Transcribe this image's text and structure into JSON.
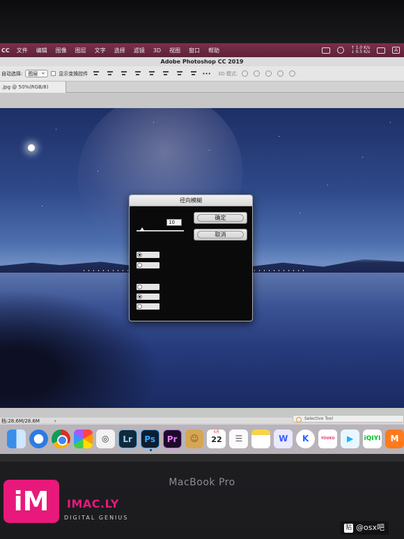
{
  "menubar": {
    "app_name": "CC",
    "items": [
      "文件",
      "编辑",
      "图像",
      "图层",
      "文字",
      "选择",
      "滤镜",
      "3D",
      "视图",
      "窗口",
      "帮助"
    ],
    "net_up": "↑ 1.0 K/s",
    "net_down": "↓ 0.5 K/s",
    "input_method": "A"
  },
  "photoshop": {
    "window_title": "Adobe Photoshop CC 2019",
    "options": {
      "auto_select_label": "自动选择:",
      "auto_select_value": "图层",
      "show_transform_label": "显示变换控件",
      "more": "•••",
      "mode_3d": "3D 模式:"
    },
    "document_tab": ".jpg @ 50%(RGB/8)",
    "status_doc": "档:28.6M/28.6M",
    "status_chevron": "›"
  },
  "dialog": {
    "title": "径向模糊",
    "amount_value": "10",
    "ok_label": "确定",
    "cancel_label": "取消"
  },
  "selective_tool": "Selective Tool",
  "dock": {
    "items": [
      {
        "name": "finder-icon",
        "glyph": ""
      },
      {
        "name": "safari-icon",
        "glyph": ""
      },
      {
        "name": "chrome-icon",
        "glyph": ""
      },
      {
        "name": "photos-icon",
        "glyph": ""
      },
      {
        "name": "screenshot-icon",
        "glyph": "◎"
      },
      {
        "name": "lightroom-icon",
        "glyph": "Lr"
      },
      {
        "name": "photoshop-icon",
        "glyph": "Ps"
      },
      {
        "name": "premiere-icon",
        "glyph": "Pr"
      },
      {
        "name": "contacts-icon",
        "glyph": "☺"
      },
      {
        "name": "calendar-icon",
        "glyph": "22",
        "month": "6月"
      },
      {
        "name": "reminders-icon",
        "glyph": "☰"
      },
      {
        "name": "notes-icon",
        "glyph": ""
      },
      {
        "name": "wps-icon",
        "glyph": "W"
      },
      {
        "name": "k-app-icon",
        "glyph": "K"
      },
      {
        "name": "youku-icon",
        "glyph": "YOUKU"
      },
      {
        "name": "infuse-icon",
        "glyph": "▶"
      },
      {
        "name": "iqiyi-icon",
        "glyph": "iQIYI"
      },
      {
        "name": "mango-tv-icon",
        "glyph": "M"
      }
    ]
  },
  "bezel_label": "MacBook Pro",
  "watermark": {
    "logo": "iM",
    "brand": "IMAC.LY",
    "tagline": "DIGITAL GENIUS",
    "post_tag": "贴",
    "post_author": "@osx吧"
  },
  "colors": {
    "menubar": "#6b2841",
    "accent_pink": "#e8197a"
  }
}
